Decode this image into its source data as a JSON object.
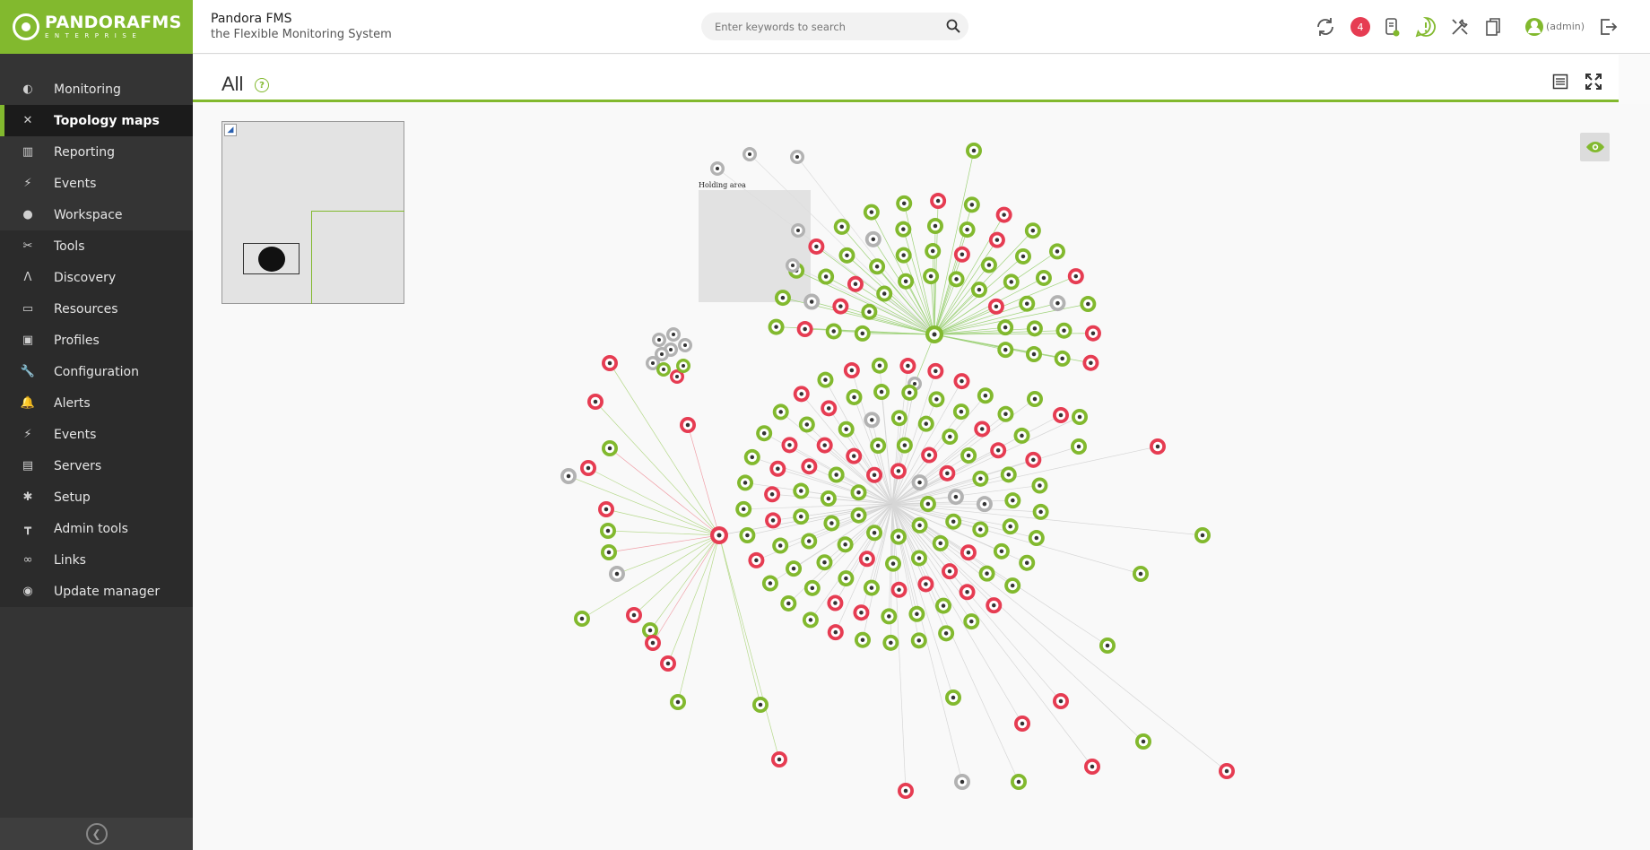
{
  "app": {
    "brand_name": "PANDORAFMS",
    "brand_sub": "ENTERPRISE",
    "title": "Pandora FMS",
    "subtitle": "the Flexible Monitoring System"
  },
  "sidebar": {
    "items": [
      {
        "label": "Monitoring",
        "icon": "monitoring-icon",
        "glyph": "◐"
      },
      {
        "label": "Topology maps",
        "icon": "topology-icon",
        "glyph": "✕",
        "active": true
      },
      {
        "label": "Reporting",
        "icon": "reporting-icon",
        "glyph": "▥"
      },
      {
        "label": "Events",
        "icon": "events-icon",
        "glyph": "⚡"
      },
      {
        "label": "Workspace",
        "icon": "workspace-icon",
        "glyph": "●"
      },
      {
        "label": "Tools",
        "icon": "tools-icon",
        "glyph": "✂"
      },
      {
        "label": "Discovery",
        "icon": "discovery-icon",
        "glyph": "Λ"
      },
      {
        "label": "Resources",
        "icon": "resources-icon",
        "glyph": "▭"
      },
      {
        "label": "Profiles",
        "icon": "profiles-icon",
        "glyph": "▣"
      },
      {
        "label": "Configuration",
        "icon": "configuration-icon",
        "glyph": "🔧"
      },
      {
        "label": "Alerts",
        "icon": "alerts-icon",
        "glyph": "🔔"
      },
      {
        "label": "Events",
        "icon": "admin-events-icon",
        "glyph": "⚡"
      },
      {
        "label": "Servers",
        "icon": "servers-icon",
        "glyph": "▤"
      },
      {
        "label": "Setup",
        "icon": "setup-icon",
        "glyph": "✱"
      },
      {
        "label": "Admin tools",
        "icon": "admin-tools-icon",
        "glyph": "┳"
      },
      {
        "label": "Links",
        "icon": "links-icon",
        "glyph": "∞"
      },
      {
        "label": "Update manager",
        "icon": "update-manager-icon",
        "glyph": "◉"
      }
    ]
  },
  "header": {
    "search_placeholder": "Enter keywords to search",
    "notification_count": "4",
    "user_label": "(admin)"
  },
  "page": {
    "title": "All",
    "help": "?"
  },
  "map": {
    "holding_area_label": "Holding area"
  },
  "colors": {
    "brand_green": "#82b92e",
    "critical_red": "#e63c52",
    "unknown_gray": "#b2b2b2",
    "sidebar_bg": "#343434"
  }
}
